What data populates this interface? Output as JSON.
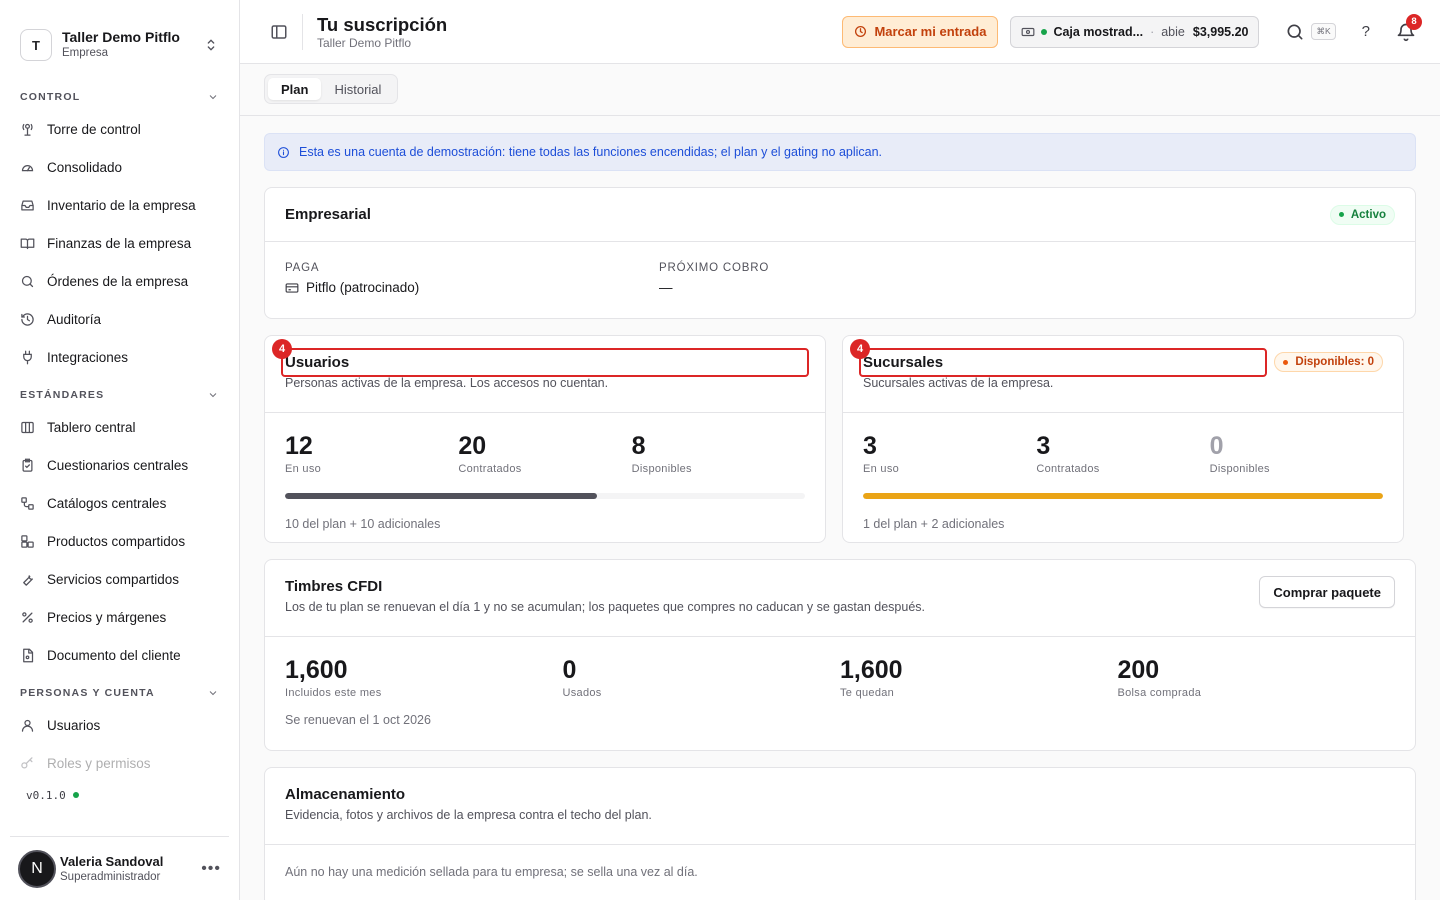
{
  "org": {
    "initial": "T",
    "name": "Taller Demo Pitflo",
    "type": "Empresa"
  },
  "sidebar": {
    "sections": [
      {
        "title": "CONTROL",
        "items": [
          {
            "label": "Torre de control",
            "icon": "tower-icon"
          },
          {
            "label": "Consolidado",
            "icon": "gauge-icon"
          },
          {
            "label": "Inventario de la empresa",
            "icon": "inbox-icon"
          },
          {
            "label": "Finanzas de la empresa",
            "icon": "book-icon"
          },
          {
            "label": "Órdenes de la empresa",
            "icon": "search-icon"
          },
          {
            "label": "Auditoría",
            "icon": "history-icon"
          },
          {
            "label": "Integraciones",
            "icon": "plug-icon"
          }
        ]
      },
      {
        "title": "ESTÁNDARES",
        "items": [
          {
            "label": "Tablero central",
            "icon": "columns-icon"
          },
          {
            "label": "Cuestionarios centrales",
            "icon": "clipboard-icon"
          },
          {
            "label": "Catálogos centrales",
            "icon": "workflow-icon"
          },
          {
            "label": "Productos compartidos",
            "icon": "boxes-icon"
          },
          {
            "label": "Servicios compartidos",
            "icon": "wrench-icon"
          },
          {
            "label": "Precios y márgenes",
            "icon": "percent-icon"
          },
          {
            "label": "Documento del cliente",
            "icon": "file-icon"
          }
        ]
      },
      {
        "title": "PERSONAS Y CUENTA",
        "items": [
          {
            "label": "Usuarios",
            "icon": "user-icon"
          },
          {
            "label": "Roles y permisos",
            "icon": "key-icon"
          }
        ]
      }
    ],
    "version": "v0.1.0"
  },
  "user": {
    "initial": "N",
    "name": "Valeria Sandoval",
    "role": "Superadministrador"
  },
  "header": {
    "title": "Tu suscripción",
    "subtitle": "Taller Demo Pitflo",
    "clock_in_label": "Marcar mi entrada",
    "register": {
      "name": "Caja mostrad...",
      "separator": "·",
      "state": "abie",
      "amount": "$3,995.20"
    },
    "search_shortcut": "⌘K",
    "help_label": "?",
    "notifications_count": "8"
  },
  "tabs": [
    {
      "label": "Plan",
      "active": true
    },
    {
      "label": "Historial",
      "active": false
    }
  ],
  "notice": "Esta es una cuenta de demostración: tiene todas las funciones encendidas; el plan y el gating no aplican.",
  "plan": {
    "name": "Empresarial",
    "status": "Activo",
    "payer_label": "PAGA",
    "payer_value": "Pitflo (patrocinado)",
    "next_charge_label": "PRÓXIMO COBRO",
    "next_charge_value": "—"
  },
  "users_card": {
    "marker": "4",
    "title": "Usuarios",
    "description": "Personas activas de la empresa. Los accesos no cuentan.",
    "in_use": "12",
    "in_use_label": "En uso",
    "contracted": "20",
    "contracted_label": "Contratados",
    "available": "8",
    "available_label": "Disponibles",
    "usage_fraction": 0.6,
    "bar_color": "#52525b",
    "footer": "10 del plan + 10 adicionales"
  },
  "branches_card": {
    "marker": "4",
    "title": "Sucursales",
    "badge": "Disponibles: 0",
    "description": "Sucursales activas de la empresa.",
    "in_use": "3",
    "in_use_label": "En uso",
    "contracted": "3",
    "contracted_label": "Contratados",
    "available": "0",
    "available_label": "Disponibles",
    "usage_fraction": 1.0,
    "bar_color": "#eaa416",
    "footer": "1 del plan + 2 adicionales"
  },
  "cfdi": {
    "title": "Timbres CFDI",
    "description": "Los de tu plan se renuevan el día 1 y no se acumulan; los paquetes que compres no caducan y se gastan después.",
    "buy_label": "Comprar paquete",
    "stats": [
      {
        "value": "1,600",
        "label": "Incluidos este mes"
      },
      {
        "value": "0",
        "label": "Usados"
      },
      {
        "value": "1,600",
        "label": "Te quedan"
      },
      {
        "value": "200",
        "label": "Bolsa comprada"
      }
    ],
    "footer": "Se renuevan el 1 oct 2026"
  },
  "storage": {
    "title": "Almacenamiento",
    "description": "Evidencia, fotos y archivos de la empresa contra el techo del plan.",
    "empty": "Aún no hay una medición sellada para tu empresa; se sella una vez al día."
  }
}
